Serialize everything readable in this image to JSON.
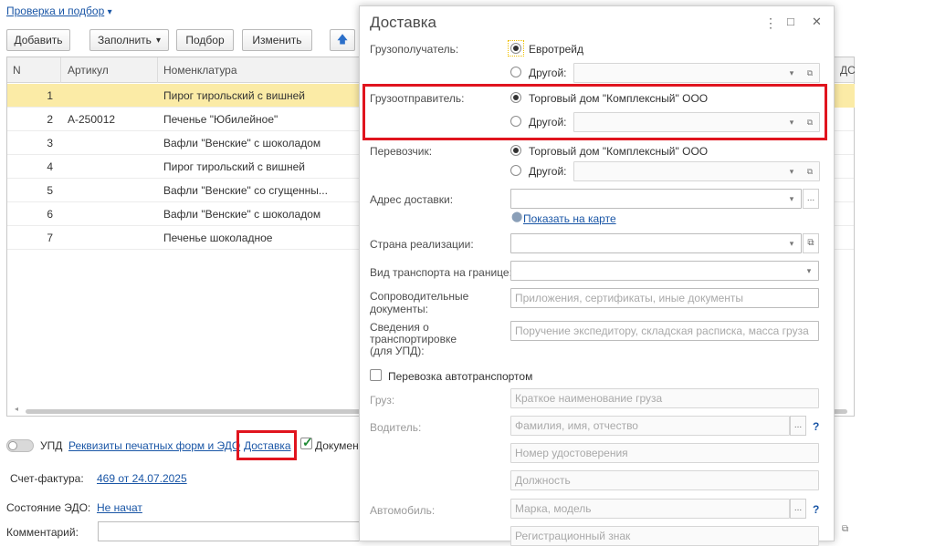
{
  "header": {
    "breadcrumb": "Проверка и подбор",
    "breadcrumb_arrow": "▾"
  },
  "toolbar": {
    "add": "Добавить",
    "fill": "Заполнить",
    "fill_arrow": "▾",
    "select": "Подбор",
    "change": "Изменить",
    "up_arrow": "🡅"
  },
  "table": {
    "columns": {
      "n": "N",
      "article": "Артикул",
      "nomenclature": "Номенклатура",
      "vat_fragment": "ДС"
    },
    "rows": [
      {
        "n": "1",
        "article": "",
        "nomenclature": "Пирог тирольский с вишней"
      },
      {
        "n": "2",
        "article": "А-250012",
        "nomenclature": "Печенье \"Юбилейное\""
      },
      {
        "n": "3",
        "article": "",
        "nomenclature": "Вафли \"Венские\" с шоколадом"
      },
      {
        "n": "4",
        "article": "",
        "nomenclature": "Пирог тирольский с вишней"
      },
      {
        "n": "5",
        "article": "",
        "nomenclature": "Вафли \"Венские\" со сгущенны..."
      },
      {
        "n": "6",
        "article": "",
        "nomenclature": "Вафли \"Венские\" с шоколадом"
      },
      {
        "n": "7",
        "article": "",
        "nomenclature": "Печенье шоколадное"
      }
    ]
  },
  "bottom": {
    "upd_label": "УПД",
    "print_forms_link": "Реквизиты печатных форм и ЭДО",
    "delivery_link": "Доставка",
    "documents_fragment": "Докумен",
    "invoice_label": "Счет-фактура:",
    "invoice_value": "469 от 24.07.2025",
    "edo_label": "Состояние ЭДО:",
    "edo_value": "Не начат",
    "comment_label": "Комментарий:"
  },
  "dialog": {
    "title": "Доставка",
    "menu_icon": "⋮",
    "maximize_icon": "□",
    "close_icon": "✕",
    "consignee": {
      "label": "Грузополучатель:",
      "option_1": "Евротрейд",
      "option_2": "Другой:"
    },
    "shipper": {
      "label": "Грузоотправитель:",
      "option_1": "Торговый дом \"Комплексный\" ООО",
      "option_2": "Другой:"
    },
    "carrier": {
      "label": "Перевозчик:",
      "option_1": "Торговый дом \"Комплексный\" ООО",
      "option_2": "Другой:"
    },
    "address": {
      "label": "Адрес доставки:",
      "map_link": "Показать на карте"
    },
    "country": {
      "label": "Страна реализации:"
    },
    "transport_type": {
      "label": "Вид транспорта на границе:"
    },
    "accompanying_docs": {
      "label_1": "Сопроводительные",
      "label_2": "документы:",
      "placeholder": "Приложения, сертификаты, иные документы"
    },
    "transport_info": {
      "label_1": "Сведения о",
      "label_2": "транспортировке",
      "label_3": "(для УПД):",
      "placeholder": "Поручение экспедитору, складская расписка, масса груза"
    },
    "road_transport": {
      "label": "Перевозка автотранспортом"
    },
    "cargo": {
      "label": "Груз:",
      "placeholder": "Краткое наименование груза"
    },
    "driver": {
      "label": "Водитель:",
      "name_placeholder": "Фамилия, имя, отчество",
      "license_placeholder": "Номер удостоверения",
      "position_placeholder": "Должность"
    },
    "vehicle": {
      "label": "Автомобиль:",
      "model_placeholder": "Марка, модель",
      "plate_placeholder": "Регистрационный знак"
    },
    "help_mark": "?",
    "dropdown_icon": "▾",
    "open_icon": "⧉",
    "ellipsis": "..."
  },
  "colors": {
    "selected_row": "#fbeba6",
    "highlight_frame": "#e0141e",
    "link": "#1a56a6"
  }
}
